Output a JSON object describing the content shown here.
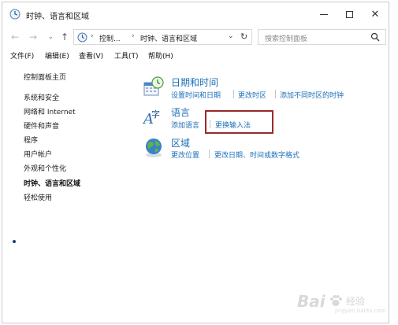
{
  "window": {
    "title": "时钟、语言和区域",
    "controls": {
      "minimize": "—",
      "maximize": "□",
      "close": "✕"
    }
  },
  "nav": {
    "back": "←",
    "forward": "→",
    "recent": "⌄",
    "up": "↑",
    "breadcrumbs": [
      "控制...",
      "时钟、语言和区域"
    ],
    "separator": "›",
    "dropdown": "⌄",
    "refresh": "↻",
    "search_placeholder": "搜索控制面板"
  },
  "menubar": [
    "文件(F)",
    "编辑(E)",
    "查看(V)",
    "工具(T)",
    "帮助(H)"
  ],
  "left_pane": {
    "home": "控制面板主页",
    "items": [
      "系统和安全",
      "网络和 Internet",
      "硬件和声音",
      "程序",
      "用户帐户",
      "外观和个性化",
      "时钟、语言和区域",
      "轻松使用"
    ],
    "current_index": 6
  },
  "categories": [
    {
      "title": "日期和时间",
      "icon": "clock-calendar-icon",
      "links": [
        "设置时间和日期",
        "更改时区",
        "添加不同时区的时钟"
      ]
    },
    {
      "title": "语言",
      "icon": "language-icon",
      "links": [
        "添加语言",
        "更换输入法"
      ]
    },
    {
      "title": "区域",
      "icon": "globe-icon",
      "links": [
        "更改位置",
        "更改日期、时间或数字格式"
      ]
    }
  ],
  "watermark": {
    "brand": "Bai",
    "text": "经验",
    "url": "jingyan.baidu.com"
  },
  "colors": {
    "link": "#1c6fb8",
    "highlight": "#9b2a2a"
  }
}
